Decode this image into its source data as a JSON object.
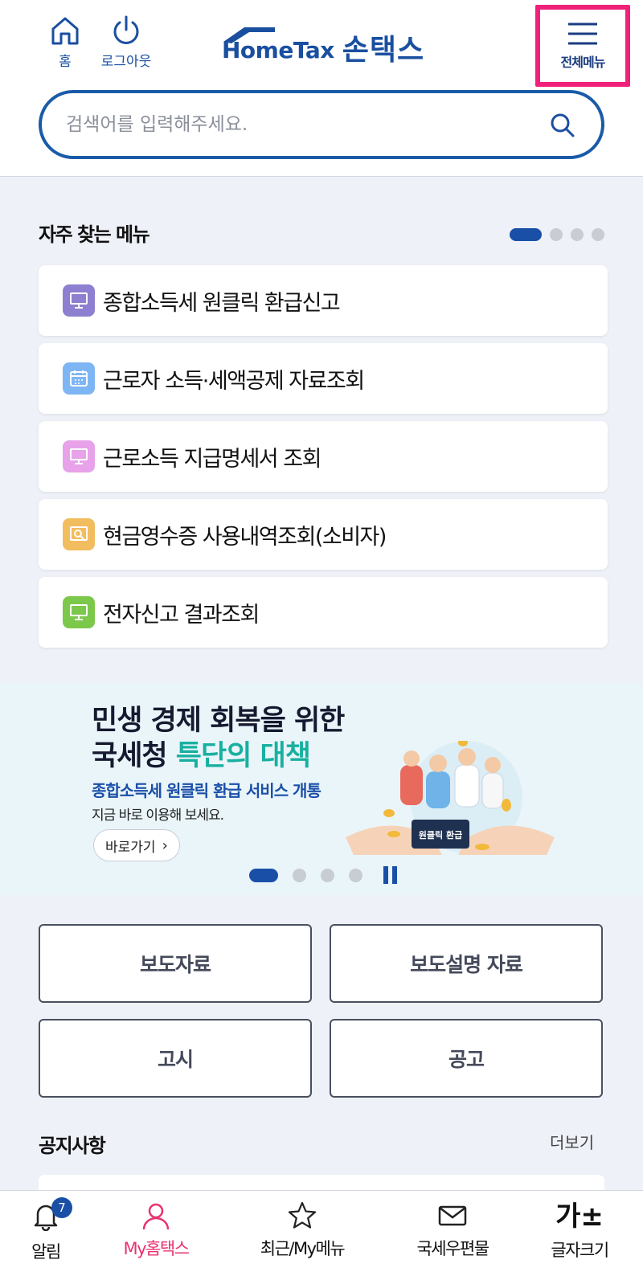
{
  "header": {
    "home_label": "홈",
    "logout_label": "로그아웃",
    "logo_text": "HomeTax",
    "logo_sub": "손택스",
    "menu_label": "전체메뉴"
  },
  "search": {
    "placeholder": "검색어를 입력해주세요."
  },
  "frequent": {
    "title": "자주 찾는 메뉴",
    "items": [
      {
        "label": "종합소득세 원클릭 환급신고",
        "icon": "monitor-icon",
        "color": "#8e7fd0"
      },
      {
        "label": "근로자 소득·세액공제 자료조회",
        "icon": "calendar-icon",
        "color": "#7eb6f5"
      },
      {
        "label": "근로소득 지급명세서 조회",
        "icon": "monitor-icon",
        "color": "#e7a2ea"
      },
      {
        "label": "현금영수증 사용내역조회(소비자)",
        "icon": "receipt-search-icon",
        "color": "#f2bd5e"
      },
      {
        "label": "전자신고 결과조회",
        "icon": "monitor-icon",
        "color": "#7cc84a"
      }
    ]
  },
  "banner": {
    "line1": "민생 경제 회복을 위한",
    "line2_pre": "국세청 ",
    "line2_hl": "특단의 대책",
    "sub": "종합소득세 원클릭 환급 서비스 개통",
    "desc": "지금 바로 이용해 보세요.",
    "go_label": "바로가기",
    "sign_text": "원클릭 환급"
  },
  "buttons": {
    "press": "보도자료",
    "press_explain": "보도설명 자료",
    "notice_gosi": "고시",
    "announce": "공고"
  },
  "notices": {
    "title": "공지사항",
    "more_label": "더보기"
  },
  "bottom_nav": {
    "alarm": "알림",
    "alarm_badge": "7",
    "my": "My홈택스",
    "recent": "최근/My메뉴",
    "mail": "국세우편물",
    "fontsize": "글자크기",
    "fontsize_glyph": "가±"
  },
  "colors": {
    "brand": "#1a4fa0",
    "highlight": "#f0217a",
    "active_nav": "#e8336f",
    "teal": "#18b0a0"
  }
}
